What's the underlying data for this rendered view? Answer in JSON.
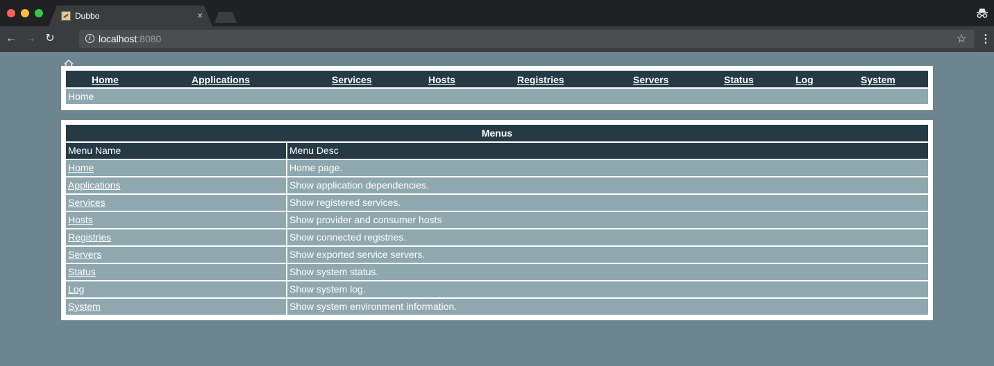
{
  "browser": {
    "tab_title": "Dubbo",
    "tab_close": "×",
    "url_host": "localhost",
    "url_port": ":8080"
  },
  "nav": {
    "links": [
      "Home",
      "Applications",
      "Services",
      "Hosts",
      "Registries",
      "Servers",
      "Status",
      "Log",
      "System"
    ],
    "breadcrumb": "Home"
  },
  "menus": {
    "title": "Menus",
    "columns": [
      "Menu Name",
      "Menu Desc"
    ],
    "rows": [
      {
        "name": "Home",
        "desc": "Home page."
      },
      {
        "name": "Applications",
        "desc": "Show application dependencies."
      },
      {
        "name": "Services",
        "desc": "Show registered services."
      },
      {
        "name": "Hosts",
        "desc": "Show provider and consumer hosts"
      },
      {
        "name": "Registries",
        "desc": "Show connected registries."
      },
      {
        "name": "Servers",
        "desc": "Show exported service servers."
      },
      {
        "name": "Status",
        "desc": "Show system status."
      },
      {
        "name": "Log",
        "desc": "Show system log."
      },
      {
        "name": "System",
        "desc": "Show system environment information."
      }
    ]
  },
  "colors": {
    "page_bg": "#6c858e",
    "header_bg": "#253a45",
    "row_bg": "#8fa7ae"
  }
}
